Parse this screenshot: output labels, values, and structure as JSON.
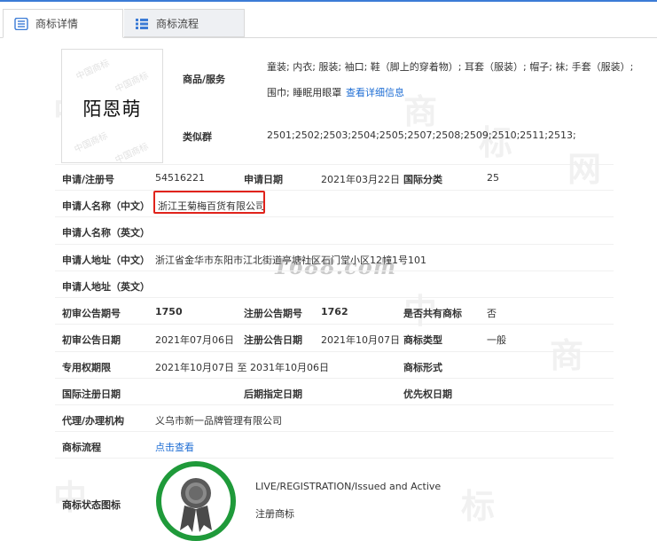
{
  "tabs": [
    {
      "label": "商标详情"
    },
    {
      "label": "商标流程"
    }
  ],
  "trademark": {
    "image_text": "陌恩萌",
    "goods_label": "商品/服务",
    "goods_line1": "童装; 内衣; 服装; 袖口; 鞋（脚上的穿着物）; 耳套（服装）; 帽子; 袜; 手套（服装）;",
    "goods_line2": "围巾; 睡眠用眼罩",
    "goods_more_link": "查看详细信息",
    "group_label": "类似群",
    "group_value": "2501;2502;2503;2504;2505;2507;2508;2509;2510;2511;2513;"
  },
  "fields": {
    "reg_no_label": "申请/注册号",
    "reg_no": "54516221",
    "apply_date_label": "申请日期",
    "apply_date": "2021年03月22日",
    "intl_class_label": "国际分类",
    "intl_class": "25",
    "applicant_cn_label": "申请人名称（中文）",
    "applicant_cn": "浙江王菊梅百货有限公司",
    "applicant_en_label": "申请人名称（英文）",
    "address_cn_label": "申请人地址（中文）",
    "address_cn": "浙江省金华市东阳市江北街道亭塘社区石门堂小区12幢1号101",
    "address_en_label": "申请人地址（英文）",
    "prelim_no_label": "初审公告期号",
    "prelim_no": "1750",
    "reg_pub_no_label": "注册公告期号",
    "reg_pub_no": "1762",
    "shared_label": "是否共有商标",
    "shared": "否",
    "prelim_date_label": "初审公告日期",
    "prelim_date": "2021年07月06日",
    "reg_pub_date_label": "注册公告日期",
    "reg_pub_date": "2021年10月07日",
    "tm_type_label": "商标类型",
    "tm_type": "一般",
    "exclusive_label": "专用权期限",
    "exclusive": "2021年10月07日 至 2031年10月06日",
    "tm_form_label": "商标形式",
    "intl_reg_date_label": "国际注册日期",
    "later_date_label": "后期指定日期",
    "priority_label": "优先权日期",
    "agent_label": "代理/办理机构",
    "agent": "义乌市新一品牌管理有限公司",
    "flow_label": "商标流程",
    "flow_link": "点击查看",
    "status_label": "商标状态图标",
    "status_en": "LIVE/REGISTRATION/Issued and Active",
    "status_cn": "注册商标"
  },
  "watermark": "1688.com",
  "colors": {
    "accent": "#1f6ed4",
    "highlight": "#e0231b",
    "badge": "#1f9a3a"
  }
}
